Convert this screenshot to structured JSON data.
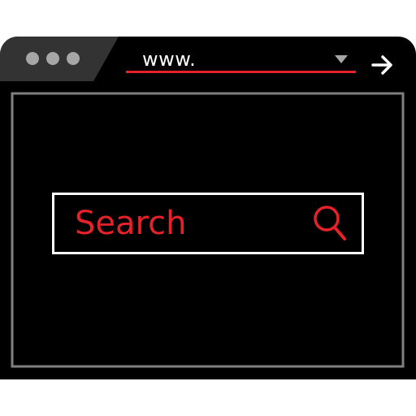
{
  "colors": {
    "window_background": "#000000",
    "title_bar": "#1a1a1a",
    "tab": "#333333",
    "dots": "#a6a6a6",
    "accent": "#e5212a",
    "content_border": "#808080",
    "search_border": "#ffffff",
    "text_light": "#ffffff"
  },
  "title_bar": {
    "window_controls": [
      "dot",
      "dot",
      "dot"
    ]
  },
  "address_bar": {
    "url_text": "www.",
    "dropdown_icon": "caret-down-icon",
    "go_icon": "arrow-right-icon"
  },
  "search": {
    "placeholder": "Search",
    "icon": "magnifier-icon"
  }
}
